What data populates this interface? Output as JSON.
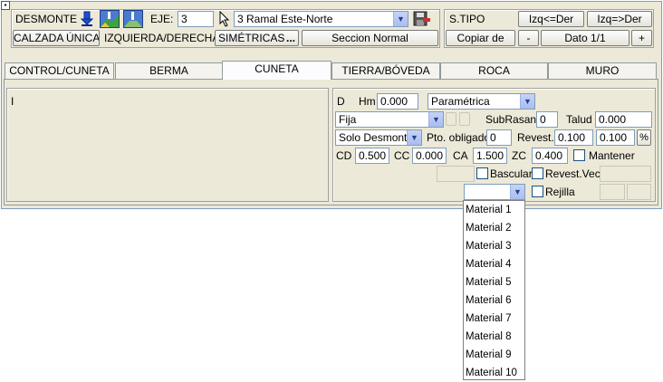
{
  "top": {
    "desmonte_label": "DESMONTE",
    "eje_label": "EJE:",
    "eje_value": "3",
    "ramal_value": "3 Ramal Este-Norte",
    "calzada_label": "CALZADA ÚNICA",
    "izq_der_label": "IZQUIERDA/DERECHA",
    "simetricas_label": "SIMÉTRICAS",
    "ellipsis": "...",
    "seccion_label": "Seccion Normal"
  },
  "stipo": {
    "title": "S.TIPO",
    "izq_der_btn": "Izq<=Der",
    "der_izq_btn": "Izq=>Der",
    "copiar_btn": "Copiar de",
    "minus_btn": "-",
    "dato_label": "Dato 1/1",
    "plus_btn": "+"
  },
  "tabs": [
    "CONTROL/CUNETA",
    "BERMA",
    "CUNETA",
    "TIERRA/BÓVEDA",
    "ROCA",
    "MURO"
  ],
  "selected_tab": "CUNETA",
  "left_panel": {
    "text": "I"
  },
  "form": {
    "d_label": "D",
    "hm_label": "Hm",
    "hm_value": "0.000",
    "mode_value": "Paramétrica",
    "fija_value": "Fija",
    "subrasante_label": "SubRasante",
    "subrasante_value": "0",
    "talud_label": "Talud",
    "talud_value": "0.000",
    "solo_value": "Solo Desmonte",
    "pto_label": "Pto. obligado",
    "pto_value": "0",
    "revest_label": "Revest.",
    "revest_value1": "0.100",
    "revest_value2": "0.100",
    "pct_btn": "%",
    "cd_label": "CD",
    "cd_value": "0.500",
    "cc_label": "CC",
    "cc_value": "0.000",
    "ca_label": "CA",
    "ca_value": "1.500",
    "zc_label": "ZC",
    "zc_value": "0.400",
    "mantener_label": "Mantener",
    "bascular_label": "Bascular",
    "revest_vec_label": "Revest.Vec.",
    "rejilla_label": "Rejilla"
  },
  "materials": [
    "Material 1",
    "Material 2",
    "Material 3",
    "Material 4",
    "Material 5",
    "Material 6",
    "Material 7",
    "Material 8",
    "Material 9",
    "Material 10"
  ],
  "colors": {
    "window_bg": "#ece9d8",
    "border": "#7f9db9",
    "tab_sel": "#fcfcfe"
  }
}
